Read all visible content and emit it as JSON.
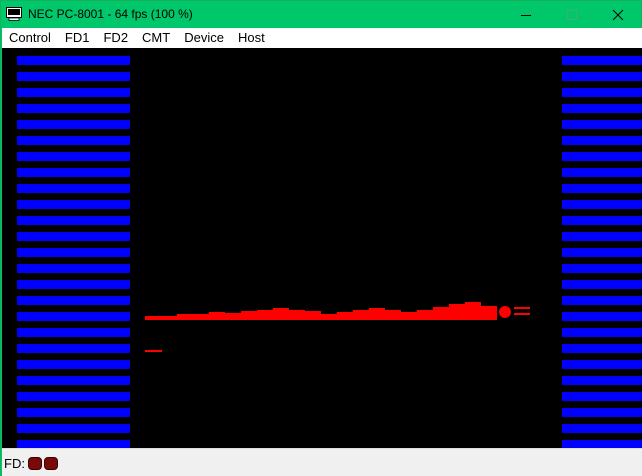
{
  "window": {
    "title": "NEC PC-8001 - 64 fps (100 %)",
    "titlebar_color": "#00c86a",
    "icons": {
      "app": "app-monitor-icon",
      "minimize": "minimize-icon",
      "maximize": "maximize-icon",
      "close": "close-icon"
    }
  },
  "menu": {
    "items": [
      {
        "label": "Control"
      },
      {
        "label": "FD1"
      },
      {
        "label": "FD2"
      },
      {
        "label": "CMT"
      },
      {
        "label": "Device"
      },
      {
        "label": "Host"
      }
    ]
  },
  "screen": {
    "background": "#000000",
    "wall_color": "#0000ff",
    "track_color": "#ff0000",
    "wall_stripe_count": 25
  },
  "status": {
    "fd_label": "FD:",
    "drive_led_count": 2,
    "led_color": "#7a0a0a"
  }
}
